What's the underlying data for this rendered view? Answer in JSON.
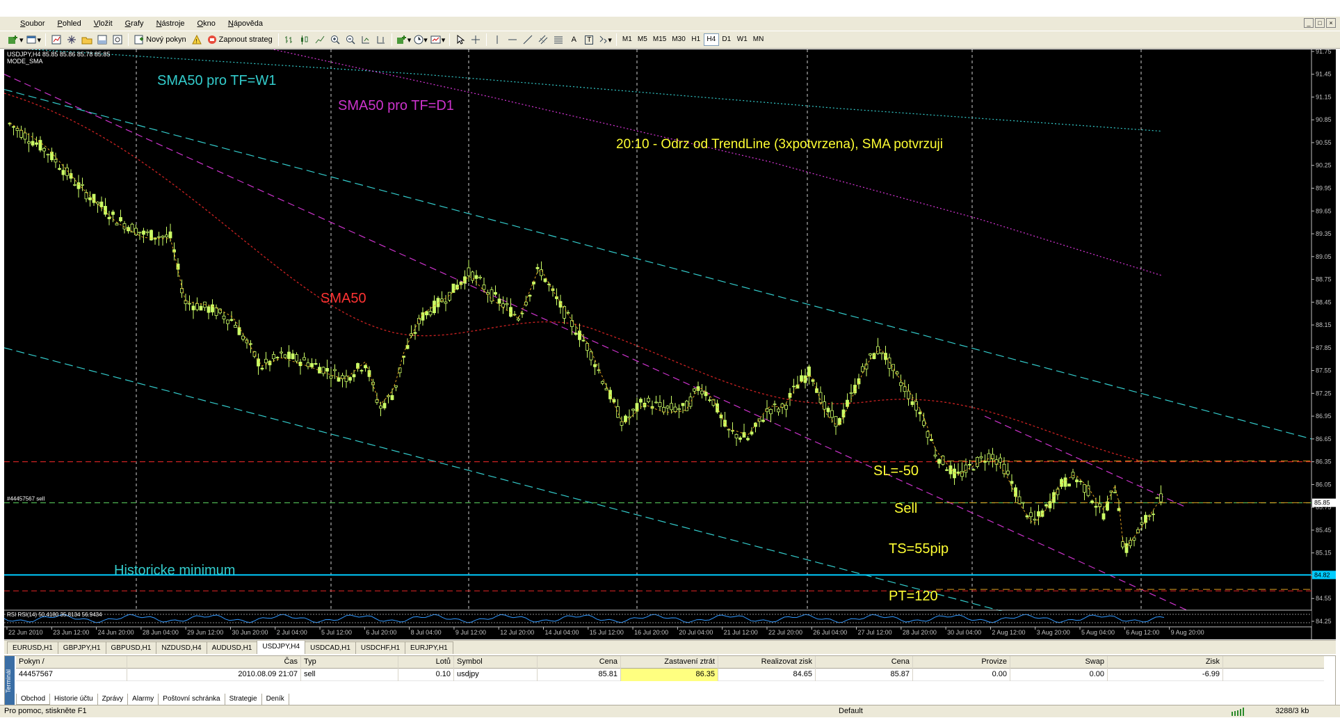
{
  "menu": [
    "Soubor",
    "Pohled",
    "Vložit",
    "Grafy",
    "Nástroje",
    "Okno",
    "Nápověda"
  ],
  "mdi_buttons": [
    "_",
    "□",
    "×"
  ],
  "toolbar": {
    "new_order": "Nový pokyn",
    "autotrading": "Zapnout strateg",
    "draw_text": "A",
    "draw_label": "T",
    "timeframes": [
      "M1",
      "M5",
      "M15",
      "M30",
      "H1",
      "H4",
      "D1",
      "W1",
      "MN"
    ],
    "active_timeframe": "H4"
  },
  "chart": {
    "symbol_info": "USDJPY,H4  85.85 85.86 85.78 85.85",
    "indicator_info": "MODE_SMA",
    "bottom_indicator_info": "RSI RSI(14) 50.4180 35.8134 56.9434",
    "order_label": "#44457567 sell",
    "current_price_label": "85.85",
    "historic_min_price_label": "84.82",
    "price_axis": [
      "91.75",
      "91.45",
      "91.15",
      "90.85",
      "90.55",
      "90.25",
      "89.95",
      "89.65",
      "89.35",
      "89.05",
      "88.75",
      "88.45",
      "88.15",
      "87.85",
      "87.55",
      "87.25",
      "86.95",
      "86.65",
      "86.35",
      "86.05",
      "85.75",
      "85.45",
      "85.15",
      "84.85",
      "84.55",
      "84.25"
    ],
    "time_axis": [
      "22 Jun 2010",
      "23 Jun 12:00",
      "24 Jun 20:00",
      "28 Jun 04:00",
      "29 Jun 12:00",
      "30 Jun 20:00",
      "2 Jul 04:00",
      "5 Jul 12:00",
      "6 Jul 20:00",
      "8 Jul 04:00",
      "9 Jul 12:00",
      "12 Jul 20:00",
      "14 Jul 04:00",
      "15 Jul 12:00",
      "16 Jul 20:00",
      "20 Jul 04:00",
      "21 Jul 12:00",
      "22 Jul 20:00",
      "26 Jul 04:00",
      "27 Jul 12:00",
      "28 Jul 20:00",
      "30 Jul 04:00",
      "2 Aug 12:00",
      "3 Aug 20:00",
      "5 Aug 04:00",
      "6 Aug 12:00",
      "9 Aug 20:00"
    ],
    "annotations": {
      "sma50_w1": "SMA50 pro TF=W1",
      "sma50_d1": "SMA50 pro TF=D1",
      "trade_note": "20:10 - Odrz od TrendLine (3xpotvrzena), SMA potvrzuji",
      "sma50": "SMA50",
      "historic_min": "Historicke minimum",
      "sl": "SL=-50",
      "sell": "Sell",
      "ts": "TS=55pip",
      "pt": "PT=120"
    },
    "colors": {
      "background": "#000000",
      "bull_candle": "#ccff66",
      "sma_w1": "#33cccc",
      "sma_d1": "#cc33cc",
      "sma50": "#cc2222",
      "annotation_yellow": "#ffff33",
      "historic_min_line": "#00ccff"
    }
  },
  "symbol_tabs": [
    "EURUSD,H1",
    "GBPJPY,H1",
    "GBPUSD,H1",
    "NZDUSD,H4",
    "AUDUSD,H1",
    "USDJPY,H4",
    "USDCAD,H1",
    "USDCHF,H1",
    "EURJPY,H1"
  ],
  "active_symbol_tab": "USDJPY,H4",
  "terminal": {
    "side_label": "Terminál",
    "headers": [
      "Pokyn  /",
      "Čas",
      "Typ",
      "Lotů",
      "Symbol",
      "Cena",
      "Zastavení ztrát",
      "Realizovat zisk",
      "Cena",
      "Provize",
      "Swap",
      "Zisk"
    ],
    "row": [
      "44457567",
      "2010.08.09 21:07",
      "sell",
      "0.10",
      "usdjpy",
      "85.81",
      "86.35",
      "84.65",
      "85.87",
      "0.00",
      "0.00",
      "-6.99"
    ],
    "tabs": [
      "Obchod",
      "Historie účtu",
      "Zprávy",
      "Alarmy",
      "Poštovní schránka",
      "Strategie",
      "Deník"
    ],
    "active_tab": "Obchod"
  },
  "status": {
    "help": "Pro pomoc, stiskněte F1",
    "profile": "Default",
    "traffic": "3288/3 kb"
  }
}
